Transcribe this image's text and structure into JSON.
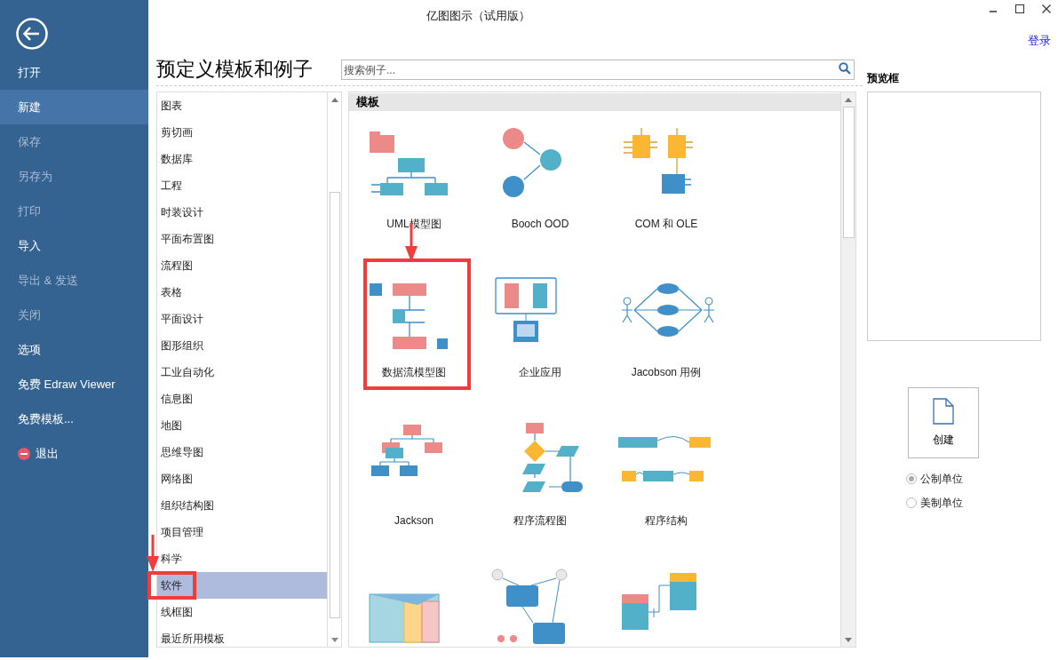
{
  "window": {
    "title": "亿图图示（试用版）",
    "login_link": "登录"
  },
  "sidebar": {
    "items": [
      {
        "label": "打开",
        "kind": "text",
        "selected": false,
        "disabled": false
      },
      {
        "label": "新建",
        "kind": "text",
        "selected": true,
        "disabled": false
      },
      {
        "label": "保存",
        "kind": "text",
        "selected": false,
        "disabled": true
      },
      {
        "label": "另存为",
        "kind": "text",
        "selected": false,
        "disabled": true
      },
      {
        "label": "打印",
        "kind": "text",
        "selected": false,
        "disabled": true
      },
      {
        "label": "导入",
        "kind": "text",
        "selected": false,
        "disabled": false
      },
      {
        "label": "导出 & 发送",
        "kind": "text",
        "selected": false,
        "disabled": true
      },
      {
        "label": "关闭",
        "kind": "text",
        "selected": false,
        "disabled": true
      },
      {
        "label": "选项",
        "kind": "text",
        "selected": false,
        "disabled": false
      },
      {
        "label": "免费 Edraw Viewer",
        "kind": "text",
        "selected": false,
        "disabled": false
      },
      {
        "label": "免费模板...",
        "kind": "text",
        "selected": false,
        "disabled": false
      },
      {
        "label": "退出",
        "kind": "exit",
        "selected": false,
        "disabled": false
      }
    ]
  },
  "heading": "预定义模板和例子",
  "search": {
    "placeholder": "搜索例子..."
  },
  "categories": [
    {
      "label": "图表",
      "selected": false,
      "annotated": false
    },
    {
      "label": "剪切画",
      "selected": false,
      "annotated": false
    },
    {
      "label": "数据库",
      "selected": false,
      "annotated": false
    },
    {
      "label": "工程",
      "selected": false,
      "annotated": false
    },
    {
      "label": "时装设计",
      "selected": false,
      "annotated": false
    },
    {
      "label": "平面布置图",
      "selected": false,
      "annotated": false
    },
    {
      "label": "流程图",
      "selected": false,
      "annotated": false
    },
    {
      "label": "表格",
      "selected": false,
      "annotated": false
    },
    {
      "label": "平面设计",
      "selected": false,
      "annotated": false
    },
    {
      "label": "图形组织",
      "selected": false,
      "annotated": false
    },
    {
      "label": "工业自动化",
      "selected": false,
      "annotated": false
    },
    {
      "label": "信息图",
      "selected": false,
      "annotated": false
    },
    {
      "label": "地图",
      "selected": false,
      "annotated": false
    },
    {
      "label": "思维导图",
      "selected": false,
      "annotated": false
    },
    {
      "label": "网络图",
      "selected": false,
      "annotated": false
    },
    {
      "label": "组织结构图",
      "selected": false,
      "annotated": false
    },
    {
      "label": "项目管理",
      "selected": false,
      "annotated": false
    },
    {
      "label": "科学",
      "selected": false,
      "annotated": false
    },
    {
      "label": "软件",
      "selected": true,
      "annotated": true
    },
    {
      "label": "线框图",
      "selected": false,
      "annotated": false
    },
    {
      "label": "最近所用模板",
      "selected": false,
      "annotated": false
    }
  ],
  "templates": {
    "header": "模板",
    "items": [
      {
        "label": "UML模型图",
        "kind": "uml",
        "annotated": false
      },
      {
        "label": "Booch OOD",
        "kind": "booch",
        "annotated": false
      },
      {
        "label": "COM 和 OLE",
        "kind": "com",
        "annotated": false
      },
      {
        "label": "数据流模型图",
        "kind": "dataflow",
        "annotated": true
      },
      {
        "label": "企业应用",
        "kind": "enterprise",
        "annotated": false
      },
      {
        "label": "Jacobson 用例",
        "kind": "usecase",
        "annotated": false
      },
      {
        "label": "Jackson",
        "kind": "jackson",
        "annotated": false
      },
      {
        "label": "程序流程图",
        "kind": "flowchart",
        "annotated": false
      },
      {
        "label": "程序结构",
        "kind": "structure",
        "annotated": false
      },
      {
        "kind": "grid",
        "annotated": false
      },
      {
        "kind": "network",
        "annotated": false
      },
      {
        "kind": "tables",
        "annotated": false
      }
    ]
  },
  "preview": {
    "title": "预览框",
    "create_button": "创建",
    "units": [
      {
        "label": "公制单位",
        "selected": true
      },
      {
        "label": "美制单位",
        "selected": false
      }
    ]
  }
}
